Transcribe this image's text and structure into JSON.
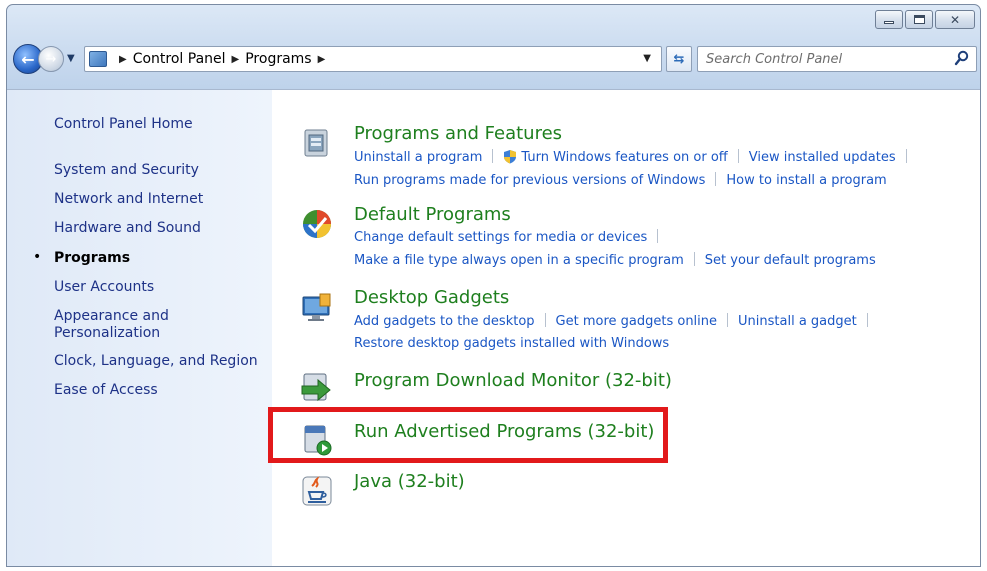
{
  "window": {
    "caption_buttons": {
      "minimize": "minimize-icon",
      "maximize": "maximize-icon",
      "close": "close-icon"
    }
  },
  "address_bar": {
    "crumbs": [
      "Control Panel",
      "Programs"
    ]
  },
  "search": {
    "placeholder": "Search Control Panel"
  },
  "sidebar": {
    "items": [
      {
        "label": "Control Panel Home"
      },
      {
        "label": "System and Security"
      },
      {
        "label": "Network and Internet"
      },
      {
        "label": "Hardware and Sound"
      },
      {
        "label": "Programs",
        "current": true
      },
      {
        "label": "User Accounts"
      },
      {
        "label": "Appearance and Personalization"
      },
      {
        "label": "Clock, Language, and Region"
      },
      {
        "label": "Ease of Access"
      }
    ]
  },
  "categories": [
    {
      "title": "Programs and Features",
      "icon": "programs-features-icon",
      "links": [
        [
          "Uninstall a program",
          "Turn Windows features on or off",
          "View installed updates"
        ],
        [
          "Run programs made for previous versions of Windows",
          "How to install a program"
        ]
      ]
    },
    {
      "title": "Default Programs",
      "icon": "default-programs-icon",
      "links": [
        [
          "Change default settings for media or devices"
        ],
        [
          "Make a file type always open in a specific program",
          "Set your default programs"
        ]
      ]
    },
    {
      "title": "Desktop Gadgets",
      "icon": "desktop-gadgets-icon",
      "links": [
        [
          "Add gadgets to the desktop",
          "Get more gadgets online",
          "Uninstall a gadget"
        ],
        [
          "Restore desktop gadgets installed with Windows"
        ]
      ]
    },
    {
      "title": "Program Download Monitor (32-bit)",
      "icon": "download-monitor-icon",
      "links": []
    },
    {
      "title": "Run Advertised Programs (32-bit)",
      "icon": "run-advertised-icon",
      "links": []
    },
    {
      "title": "Java (32-bit)",
      "icon": "java-icon",
      "links": []
    }
  ],
  "colors": {
    "category_title": "#1e7f1e",
    "link": "#1a56c4",
    "highlight": "#e2191b"
  }
}
